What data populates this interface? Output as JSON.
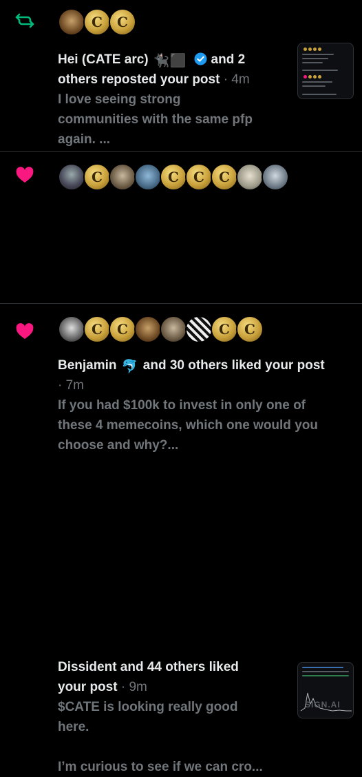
{
  "notifications": [
    {
      "kind": "repost",
      "icon": "repost-icon",
      "icon_color": "#00ba7c",
      "avatars": [
        "avatar-1",
        "avatar-2",
        "avatar-3"
      ],
      "actor": "Hei (CATE arc)",
      "actor_emoji": "🐈‍⬛⬛",
      "verified": true,
      "action_line1_end": "and 2",
      "action_line2": "others reposted your post",
      "time": "· 4m",
      "body_lines": [
        "I love seeing strong",
        "communities with the same pfp",
        "again. ..."
      ]
    },
    {
      "kind": "like",
      "icon": "heart-icon",
      "icon_color": "#f91880",
      "actor": "Benjamin",
      "actor_emoji": "🐬",
      "action": "and 30 others liked your post",
      "time": "· 7m",
      "body_lines": [
        "If you had $100k to invest in only one of",
        "these 4 memecoins, which one would you",
        "choose and why?..."
      ]
    },
    {
      "kind": "like",
      "icon": "heart-icon",
      "icon_color": "#f91880",
      "actor_line": "Dissident and 44 others liked",
      "action_line2": "your post",
      "time": "· 9m",
      "body_lines": [
        "$CATE is looking really good",
        "here.",
        "I’m curious to see if we can cro..."
      ],
      "thumb_watermark": "SIGN.AI"
    }
  ],
  "colors": {
    "background": "#000000",
    "text": "#e7e9ea",
    "muted": "#71767b",
    "divider": "#2f3336",
    "verified": "#1d9bf0"
  }
}
